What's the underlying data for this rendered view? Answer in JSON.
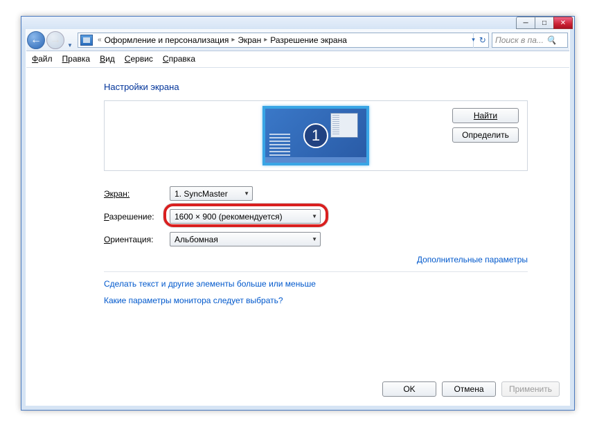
{
  "window_controls": {
    "min": "—",
    "max": "▢",
    "close": "✕"
  },
  "breadcrumb": {
    "prefix": "«",
    "seg1": "Оформление и персонализация",
    "seg2": "Экран",
    "seg3": "Разрешение экрана"
  },
  "search": {
    "placeholder": "Поиск в па..."
  },
  "menu": {
    "file": "Файл",
    "edit": "Правка",
    "view": "Вид",
    "tools": "Сервис",
    "help": "Справка"
  },
  "page": {
    "title": "Настройки экрана",
    "monitor_number": "1",
    "find_btn": "Найти",
    "identify_btn": "Определить"
  },
  "form": {
    "screen_label": "Экран:",
    "screen_value": "1. SyncMaster",
    "resolution_label_pre": "Р",
    "resolution_label_post": "азрешение:",
    "resolution_value": "1600 × 900 (рекомендуется)",
    "orientation_label_pre": "О",
    "orientation_label_post": "риентация:",
    "orientation_value": "Альбомная"
  },
  "links": {
    "advanced": "Дополнительные параметры",
    "text_size": "Сделать текст и другие элементы больше или меньше",
    "which_settings": "Какие параметры монитора следует выбрать?"
  },
  "footer": {
    "ok": "OK",
    "cancel": "Отмена",
    "apply": "Применить"
  }
}
